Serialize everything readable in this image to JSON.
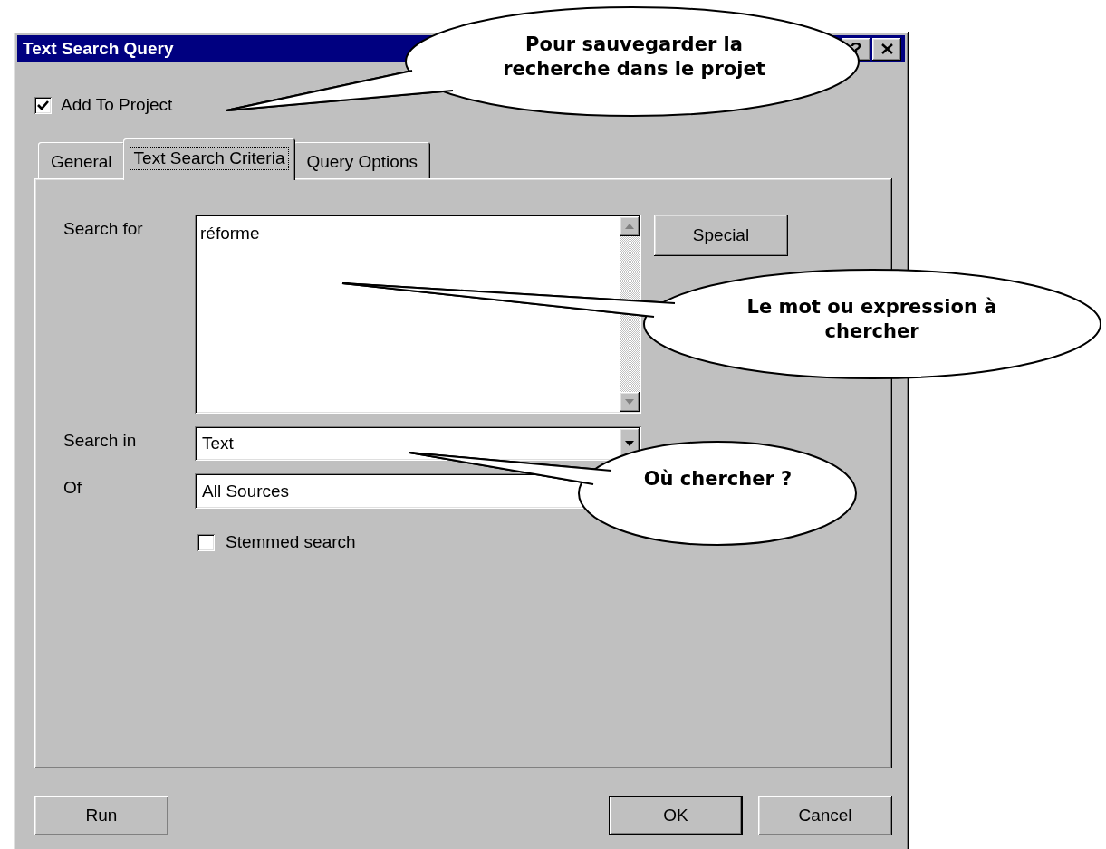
{
  "window": {
    "title": "Text Search Query"
  },
  "add_to_project": {
    "label": "Add To Project",
    "checked": true
  },
  "tabs": [
    {
      "label": "General",
      "selected": false
    },
    {
      "label": "Text Search Criteria",
      "selected": true
    },
    {
      "label": "Query Options",
      "selected": false
    }
  ],
  "search_for": {
    "label": "Search for",
    "value": "réforme"
  },
  "special_button": "Special",
  "search_in": {
    "label": "Search in",
    "value": "Text"
  },
  "of": {
    "label": "Of",
    "value": "All Sources"
  },
  "stemmed_search": {
    "label": "Stemmed search",
    "checked": false
  },
  "buttons": [
    {
      "label": "Run",
      "default": false
    },
    {
      "label": "OK",
      "default": true
    },
    {
      "label": "Cancel",
      "default": false
    }
  ],
  "callouts": [
    {
      "text": "Pour sauvegarder la recherche dans le projet"
    },
    {
      "text": "Le mot ou expression à chercher"
    },
    {
      "text": "Où chercher ?"
    }
  ]
}
